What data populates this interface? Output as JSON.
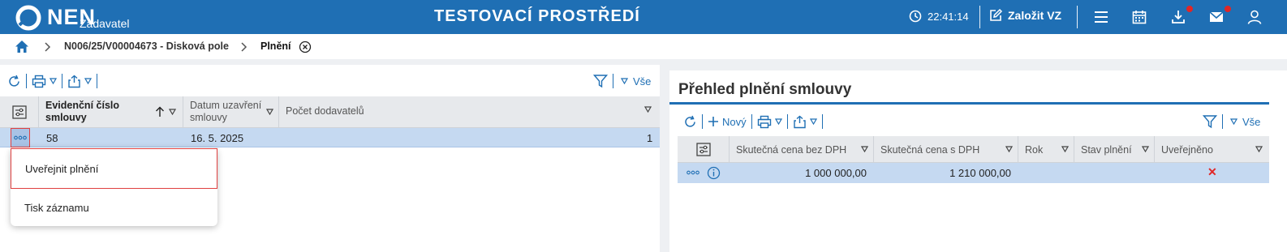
{
  "header": {
    "logo_text": "NEN",
    "logo_sub": "Zadavatel",
    "env_title": "TESTOVACÍ PROSTŘEDÍ",
    "clock": "22:41:14",
    "create_label": "Založit VZ"
  },
  "breadcrumb": {
    "item1": "N006/25/V00004673 - Disková pole",
    "item2": "Plnění"
  },
  "left_grid": {
    "filter_label": "Vše",
    "columns": [
      "Evidenční číslo smlouvy",
      "Datum uzavření smlouvy",
      "Počet dodavatelů"
    ],
    "rows": [
      {
        "evidencni_cislo": "58",
        "datum": "16. 5. 2025",
        "pocet": "1"
      }
    ]
  },
  "context_menu": {
    "items": [
      "Uveřejnit plnění",
      "Tisk záznamu"
    ]
  },
  "right_panel": {
    "title": "Přehled plnění smlouvy",
    "new_label": "Nový",
    "filter_label": "Vše",
    "columns": [
      "Skutečná cena bez DPH",
      "Skutečná cena s DPH",
      "Rok",
      "Stav plnění",
      "Uveřejněno"
    ],
    "rows": [
      {
        "cena_bez_dph": "1 000 000,00",
        "cena_s_dph": "1 210 000,00",
        "rok": "",
        "stav": "",
        "uverejneno": "✕"
      }
    ]
  },
  "colors": {
    "brand": "#1f6fb4",
    "selected_row": "#c5d9f1",
    "alert_red": "#e12626"
  }
}
